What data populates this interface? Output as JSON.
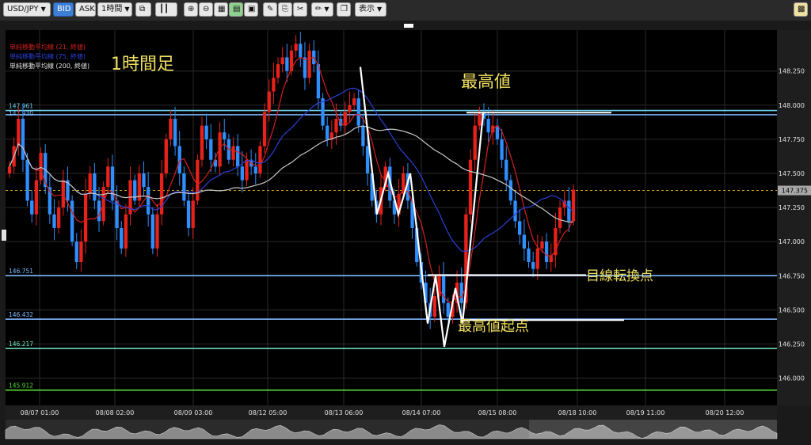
{
  "toolbar": {
    "symbol": "USD/JPY",
    "bid_label": "BID",
    "ask_label": "ASK",
    "timeframe": "1時間",
    "display_label": "表示",
    "icons": [
      "window-icon",
      "candle-type-icon",
      "zoom-in-icon",
      "zoom-out-icon",
      "table-icon",
      "indicator-icon",
      "window-icon-2",
      "draw-icon",
      "copy-icon",
      "paste-icon",
      "pen-icon",
      "layers-icon",
      "settings-icon"
    ]
  },
  "legend": {
    "ma21": "単純移動平均線 (21, 終値)",
    "ma75": "単純移動平均線 (75, 終値)",
    "ma200": "単純移動平均線 (200, 終値)"
  },
  "annotations": {
    "timeframe_title": "1時間足",
    "high": "最高値",
    "high_start": "最高値起点",
    "target": "目線転換点"
  },
  "chart_data": {
    "type": "candlestick",
    "instrument": "USD/JPY",
    "timeframe": "1時間",
    "ylim": [
      145.8,
      148.55
    ],
    "y_ticks": [
      "148.250",
      "148.000",
      "147.750",
      "147.500",
      "147.250",
      "147.000",
      "146.750",
      "146.500",
      "146.250",
      "146.000"
    ],
    "x_ticks": [
      "08/07 01:00",
      "08/08 02:00",
      "08/09 03:00",
      "08/12 05:00",
      "08/13 06:00",
      "08/14 07:00",
      "08/15 08:00",
      "08/18 10:00",
      "08/19 11:00",
      "08/20 12:00"
    ],
    "current_price": "147.375",
    "levels": [
      {
        "label": "147.961",
        "value": 147.961,
        "color": "#6fd3e8"
      },
      {
        "label": "147.930",
        "value": 147.93,
        "color": "#7fb8ff"
      },
      {
        "label": "146.751",
        "value": 146.751,
        "color": "#7fb8ff"
      },
      {
        "label": "146.432",
        "value": 146.432,
        "color": "#7fb8ff"
      },
      {
        "label": "146.217",
        "value": 146.217,
        "color": "#6fe8c8"
      },
      {
        "label": "145.912",
        "value": 145.912,
        "color": "#55dd33"
      }
    ],
    "series": [
      {
        "name": "単純移動平均線 (21, 終値)",
        "color": "#d42020"
      },
      {
        "name": "単純移動平均線 (75, 終値)",
        "color": "#2b3fd6"
      },
      {
        "name": "単純移動平均線 (200, 終値)",
        "color": "#c8c8c8"
      }
    ],
    "closes": [
      147.55,
      147.7,
      147.9,
      147.6,
      147.3,
      147.2,
      147.45,
      147.65,
      147.4,
      147.2,
      147.1,
      147.25,
      147.45,
      147.3,
      147.0,
      146.85,
      147.0,
      147.35,
      147.5,
      147.3,
      147.15,
      147.4,
      147.55,
      147.3,
      147.1,
      146.95,
      147.2,
      147.45,
      147.3,
      147.5,
      147.4,
      147.2,
      146.95,
      147.2,
      147.5,
      147.75,
      147.9,
      147.7,
      147.5,
      147.3,
      147.1,
      147.3,
      147.6,
      147.85,
      147.75,
      147.6,
      147.55,
      147.8,
      147.75,
      147.6,
      147.7,
      147.55,
      147.45,
      147.6,
      147.55,
      147.5,
      147.7,
      147.95,
      148.1,
      148.2,
      148.3,
      148.35,
      148.25,
      148.4,
      148.45,
      148.35,
      148.2,
      148.4,
      148.3,
      148.05,
      147.85,
      147.75,
      147.8,
      147.9,
      147.85,
      147.95,
      148.0,
      148.05,
      147.85,
      147.7,
      147.5,
      147.3,
      147.2,
      147.4,
      147.55,
      147.3,
      147.2,
      147.35,
      147.5,
      147.3,
      147.1,
      146.85,
      146.7,
      146.55,
      146.45,
      146.6,
      146.75,
      146.55,
      146.45,
      146.55,
      146.7,
      146.55,
      147.2,
      147.6,
      147.85,
      147.95,
      147.9,
      147.8,
      147.85,
      147.75,
      147.6,
      147.45,
      147.3,
      147.15,
      147.05,
      146.95,
      146.85,
      146.8,
      146.95,
      147.0,
      146.85,
      146.9,
      147.1,
      147.25,
      147.3,
      147.15,
      147.38
    ]
  }
}
